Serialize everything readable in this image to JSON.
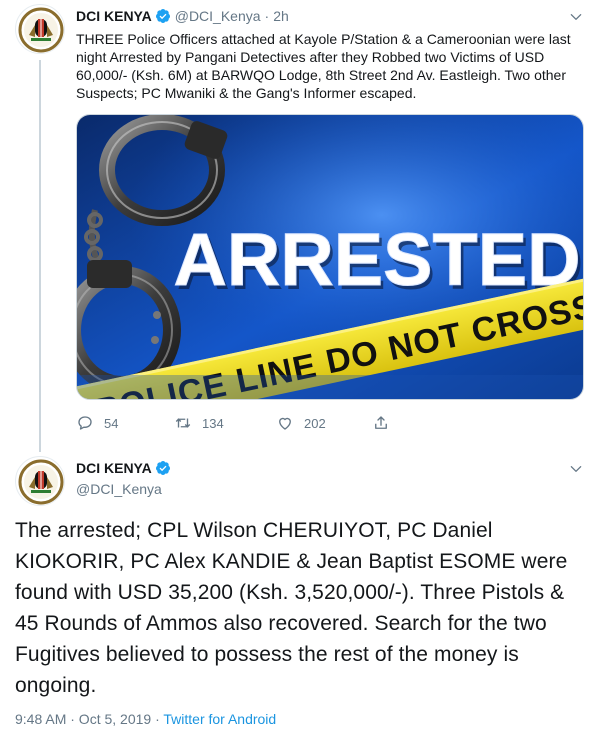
{
  "tweet1": {
    "author_name": "DCI KENYA",
    "handle": "@DCI_Kenya",
    "separator": "·",
    "time": "2h",
    "text": "THREE Police Officers attached at Kayole P/Station & a Cameroonian were last night Arrested by Pangani Detectives after they Robbed two Victims of USD 60,000/- (Ksh. 6M) at BARWQO Lodge, 8th Street 2nd Av. Eastleigh. Two other Suspects; PC Mwaniki & the Gang's Informer escaped.",
    "media": {
      "headline": "ARRESTED",
      "tape_text": "POLICE LINE DO NOT CROSS"
    },
    "stats": {
      "replies": "54",
      "retweets": "134",
      "likes": "202"
    }
  },
  "tweet2": {
    "author_name": "DCI KENYA",
    "handle": "@DCI_Kenya",
    "text": "The arrested; CPL Wilson CHERUIYOT, PC Daniel KIOKORIR, PC Alex KANDIE & Jean Baptist ESOME were found with USD 35,200 (Ksh. 3,520,000/-). Three Pistols & 45 Rounds of Ammos also recovered. Search for the two Fugitives believed to possess the rest of the money is ongoing.",
    "timestamp": "9:48 AM · Oct 5, 2019 · ",
    "source": "Twitter for Android"
  },
  "icons": {
    "reply": "speech-bubble-icon",
    "retweet": "retweet-arrows-icon",
    "like": "heart-icon",
    "share": "share-upload-icon",
    "verified": "verified-badge-icon",
    "more": "chevron-down-icon"
  },
  "colors": {
    "verified_blue": "#1da1f2",
    "secondary_text": "#657786",
    "link": "#1b95e0",
    "primary_text": "#14171a",
    "thread_line": "#ccd6dd"
  }
}
